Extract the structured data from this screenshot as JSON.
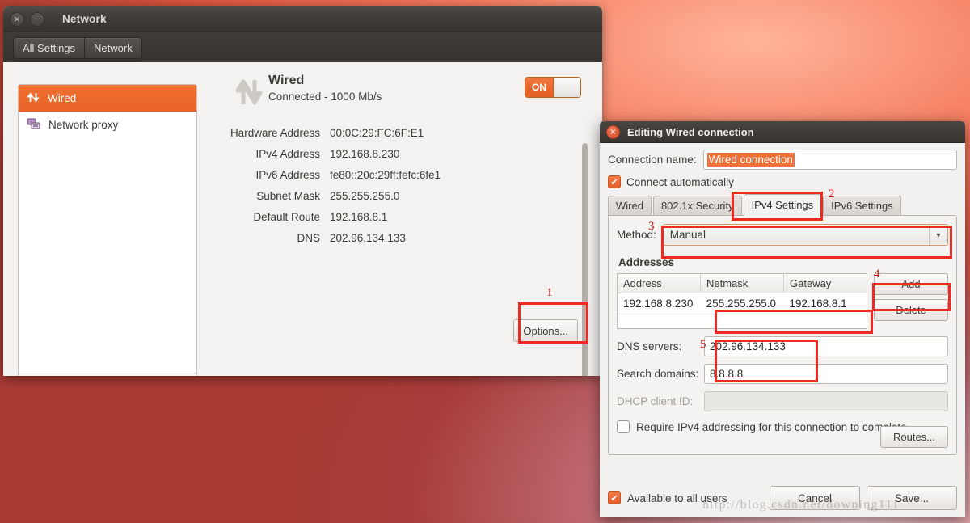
{
  "window": {
    "title": "Network",
    "close_icon": "×",
    "minimize_icon": "−",
    "toolbar": {
      "all_settings": "All Settings",
      "network": "Network"
    }
  },
  "sidebar": {
    "items": [
      {
        "label": "Wired",
        "icon": "wired-arrows-icon",
        "selected": true
      },
      {
        "label": "Network proxy",
        "icon": "network-proxy-icon",
        "selected": false
      }
    ],
    "add_label": "+",
    "remove_label": "−"
  },
  "device": {
    "name": "Wired",
    "status": "Connected - 1000 Mb/s",
    "toggle": "ON",
    "details": [
      {
        "label": "Hardware Address",
        "value": "00:0C:29:FC:6F:E1"
      },
      {
        "label": "IPv4 Address",
        "value": "192.168.8.230"
      },
      {
        "label": "IPv6 Address",
        "value": "fe80::20c:29ff:fefc:6fe1"
      },
      {
        "label": "Subnet Mask",
        "value": "255.255.255.0"
      },
      {
        "label": "Default Route",
        "value": "192.168.8.1"
      },
      {
        "label": "DNS",
        "value": "202.96.134.133"
      }
    ],
    "options_button": "Options..."
  },
  "dialog": {
    "title": "Editing Wired connection",
    "close_icon": "×",
    "connection_name_label": "Connection name:",
    "connection_name_value": "Wired connection",
    "connect_automatically_label": "Connect automatically",
    "connect_automatically_checked": true,
    "check_glyph": "✔",
    "tabs": [
      {
        "label": "Wired",
        "active": false
      },
      {
        "label": "802.1x Security",
        "active": false
      },
      {
        "label": "IPv4 Settings",
        "active": true
      },
      {
        "label": "IPv6 Settings",
        "active": false
      }
    ],
    "method_label": "Method:",
    "method_value": "Manual",
    "method_arrow": "▼",
    "addresses_title": "Addresses",
    "address_columns": [
      "Address",
      "Netmask",
      "Gateway"
    ],
    "address_rows": [
      [
        "192.168.8.230",
        "255.255.255.0",
        "192.168.8.1"
      ]
    ],
    "add_button": "Add",
    "delete_button": "Delete",
    "dns_servers_label": "DNS servers:",
    "dns_servers_value": "202.96.134.133",
    "search_domains_label": "Search domains:",
    "search_domains_value": "8.8.8.8",
    "dhcp_client_id_label": "DHCP client ID:",
    "dhcp_client_id_value": "",
    "require_ipv4_label": "Require IPv4 addressing for this connection to complete",
    "require_ipv4_checked": false,
    "routes_button": "Routes...",
    "available_all_users_label": "Available to all users",
    "available_all_users_checked": true,
    "cancel_button": "Cancel",
    "save_button": "Save..."
  },
  "annotations": {
    "n1": "1",
    "n2": "2",
    "n3": "3",
    "n4": "4",
    "n5": "5",
    "color": "#ee2a23"
  },
  "watermark": "http://blog.csdn.net/downing111"
}
